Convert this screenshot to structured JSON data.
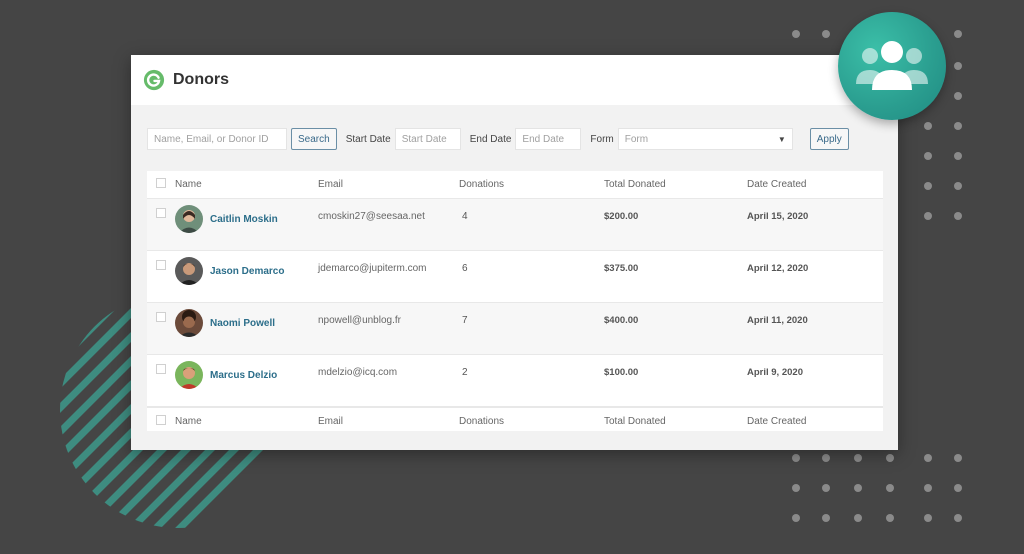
{
  "header": {
    "title": "Donors"
  },
  "filters": {
    "search_placeholder": "Name, Email, or Donor ID",
    "search_button": "Search",
    "start_label": "Start Date",
    "start_placeholder": "Start Date",
    "end_label": "End Date",
    "end_placeholder": "End Date",
    "form_label": "Form",
    "form_placeholder": "Form",
    "apply_button": "Apply"
  },
  "table": {
    "columns": [
      "Name",
      "Email",
      "Donations",
      "Total Donated",
      "Date Created"
    ],
    "rows": [
      {
        "name": "Caitlin Moskin",
        "email": "cmoskin27@seesaa.net",
        "donations": "4",
        "total": "$200.00",
        "date": "April 15, 2020",
        "avatar_color": "#6f8f7a"
      },
      {
        "name": "Jason Demarco",
        "email": "jdemarco@jupiterm.com",
        "donations": "6",
        "total": "$375.00",
        "date": "April 12, 2020",
        "avatar_color": "#4a4a4a"
      },
      {
        "name": "Naomi Powell",
        "email": "npowell@unblog.fr",
        "donations": "7",
        "total": "$400.00",
        "date": "April 11, 2020",
        "avatar_color": "#5b3a2e"
      },
      {
        "name": "Marcus Delzio",
        "email": "mdelzio@icq.com",
        "donations": "2",
        "total": "$100.00",
        "date": "April 9, 2020",
        "avatar_color": "#7ab55c"
      }
    ]
  },
  "colors": {
    "accent": "#2c6e8a",
    "brand_green": "#66bb6a",
    "badge_teal": "#2a9d8f"
  }
}
